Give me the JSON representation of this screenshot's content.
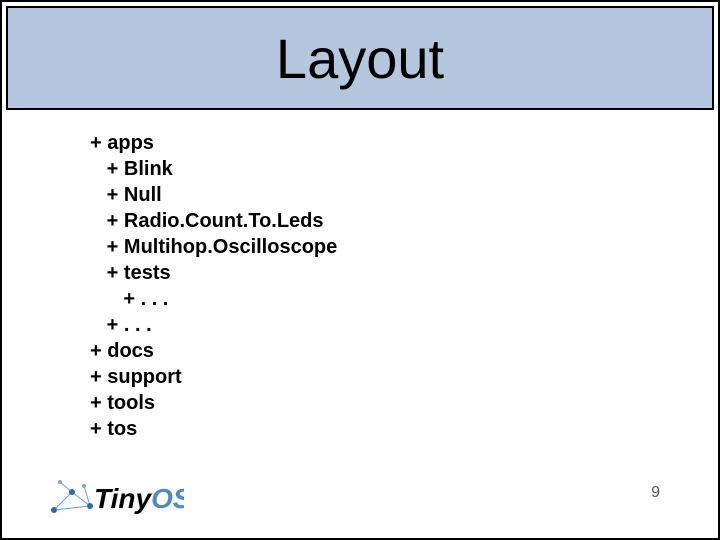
{
  "slide": {
    "title": "Layout",
    "page_number": "9",
    "logo_text": "TinyOS"
  },
  "tree": {
    "nodes": [
      {
        "indent": 0,
        "label": "apps"
      },
      {
        "indent": 1,
        "label": "Blink"
      },
      {
        "indent": 1,
        "label": "Null"
      },
      {
        "indent": 1,
        "label": "Radio.Count.To.Leds"
      },
      {
        "indent": 1,
        "label": "Multihop.Oscilloscope"
      },
      {
        "indent": 1,
        "label": "tests"
      },
      {
        "indent": 2,
        "label": ". . ."
      },
      {
        "indent": 1,
        "label": ". . ."
      },
      {
        "indent": 0,
        "label": "docs"
      },
      {
        "indent": 0,
        "label": "support"
      },
      {
        "indent": 0,
        "label": "tools"
      },
      {
        "indent": 0,
        "label": "tos"
      }
    ]
  }
}
